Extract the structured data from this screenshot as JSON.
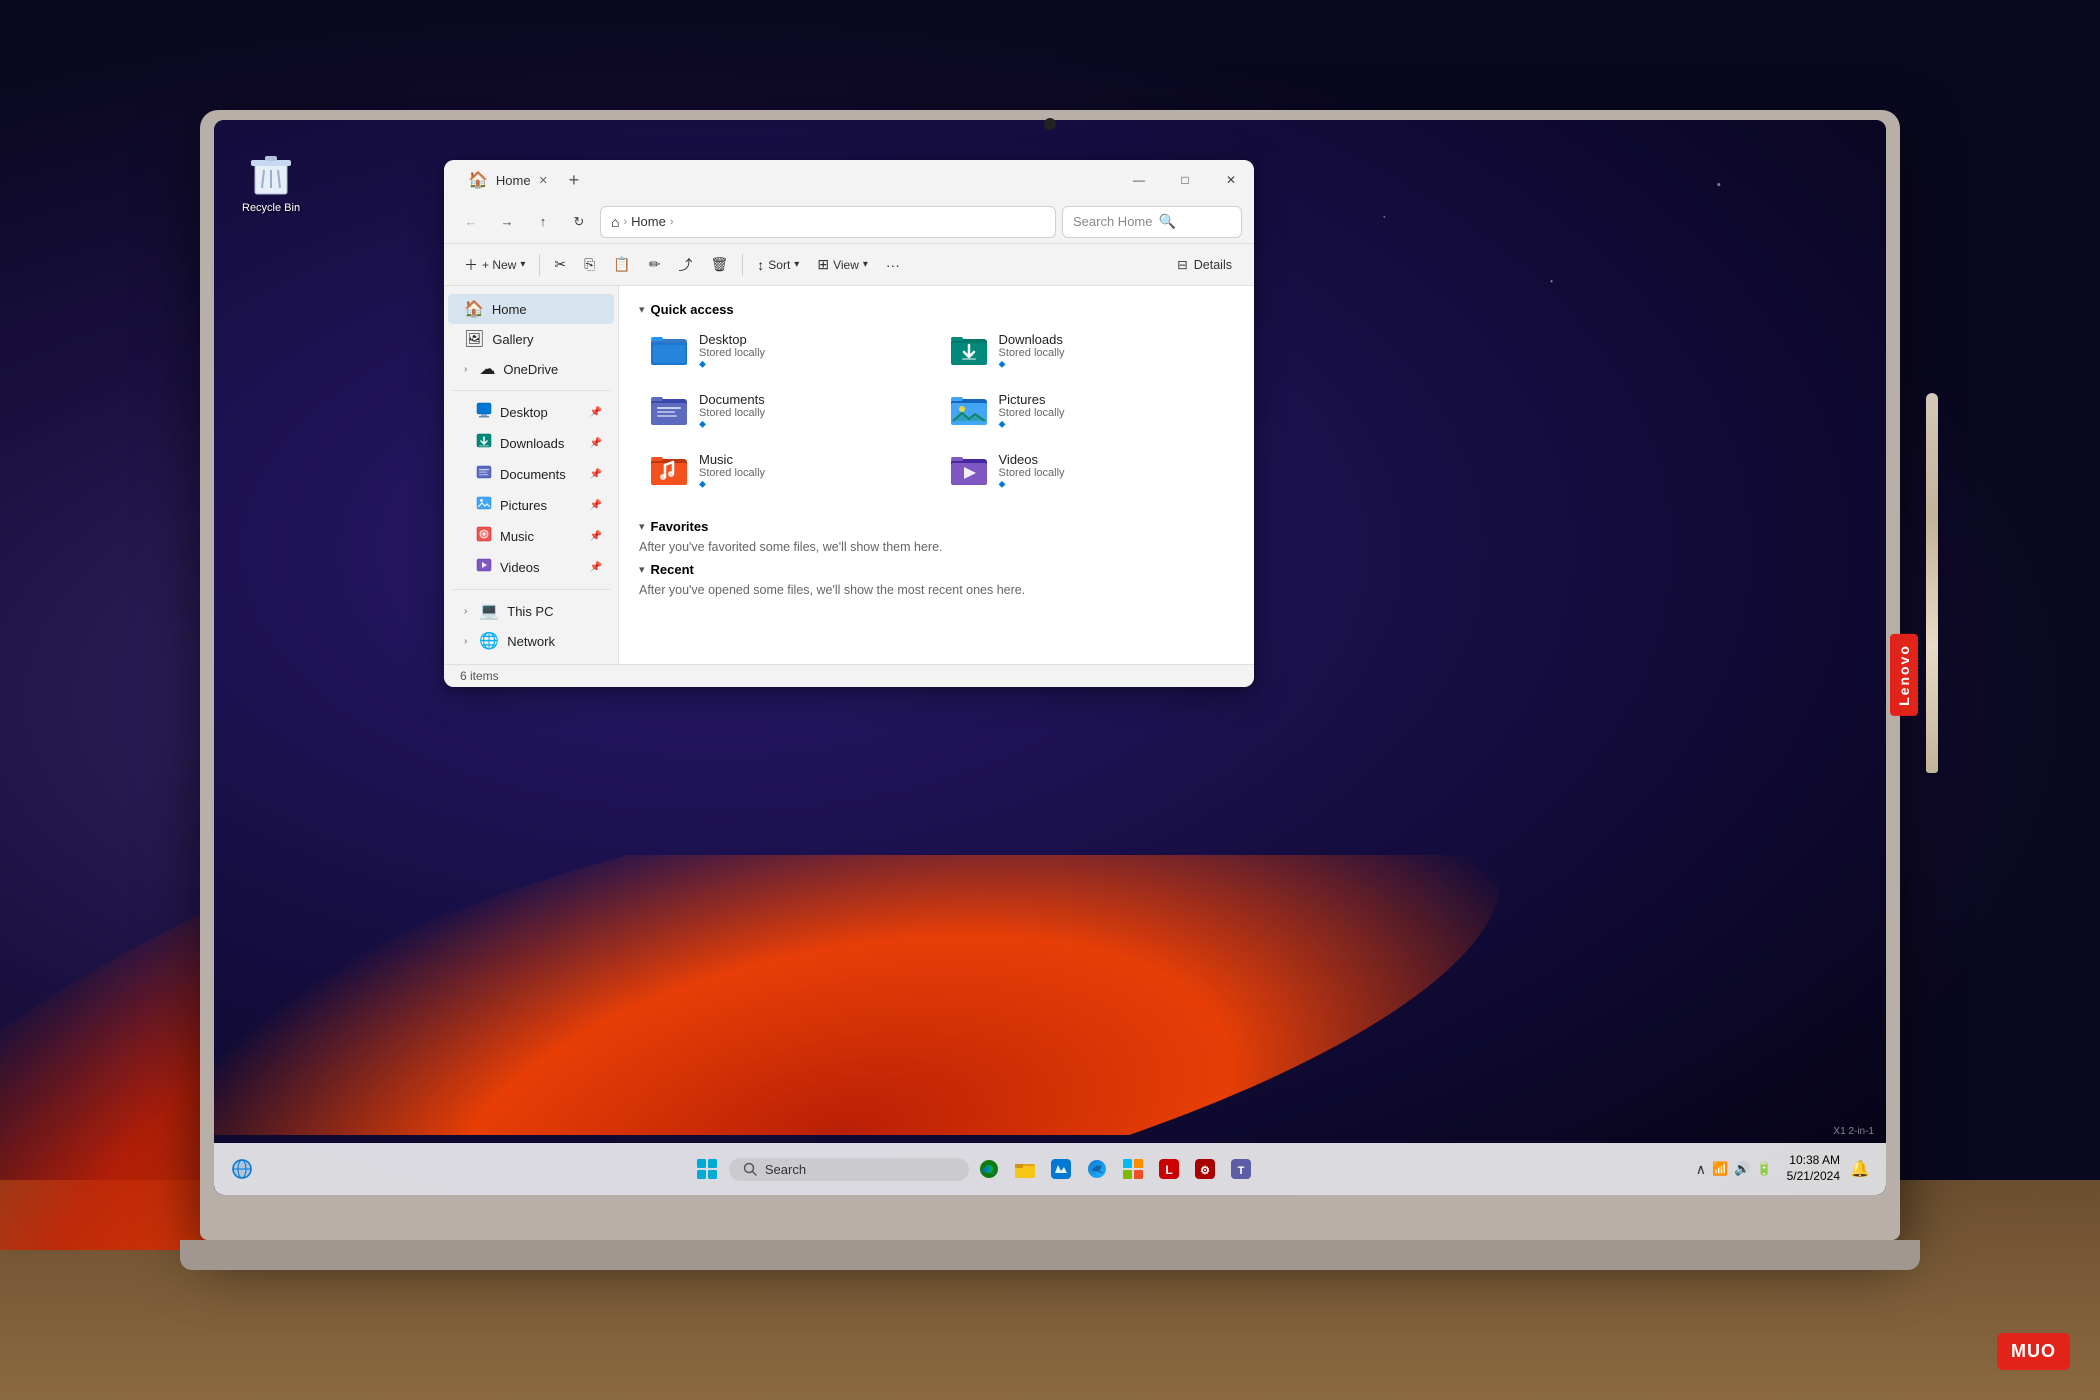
{
  "window_title": "Home",
  "tab_label": "Home",
  "add_tab": "+",
  "window_controls": {
    "minimize": "—",
    "maximize": "□",
    "close": "✕"
  },
  "nav": {
    "back": "←",
    "forward": "→",
    "up": "↑",
    "refresh": "↻",
    "home": "⌂",
    "breadcrumb": [
      "Home"
    ],
    "search_placeholder": "Search Home"
  },
  "commands": {
    "new": "+ New",
    "cut": "✂",
    "copy": "⎘",
    "paste": "📋",
    "rename": "✏",
    "share": "⤴",
    "delete": "🗑",
    "sort": "Sort",
    "view": "View",
    "more": "···",
    "details": "Details"
  },
  "sidebar": {
    "items": [
      {
        "icon": "🏠",
        "label": "Home",
        "active": true
      },
      {
        "icon": "🖼",
        "label": "Gallery"
      },
      {
        "icon": "☁",
        "label": "OneDrive",
        "expandable": true
      },
      {
        "icon": "🖥",
        "label": "Desktop",
        "pinned": true,
        "indent": true
      },
      {
        "icon": "⬇",
        "label": "Downloads",
        "pinned": true,
        "indent": true
      },
      {
        "icon": "📄",
        "label": "Documents",
        "pinned": true,
        "indent": true
      },
      {
        "icon": "🖼",
        "label": "Pictures",
        "pinned": true,
        "indent": true
      },
      {
        "icon": "🎵",
        "label": "Music",
        "pinned": true,
        "indent": true
      },
      {
        "icon": "🎬",
        "label": "Videos",
        "pinned": true,
        "indent": true
      },
      {
        "icon": "💻",
        "label": "This PC",
        "expandable": true
      },
      {
        "icon": "🌐",
        "label": "Network",
        "expandable": true
      }
    ]
  },
  "quick_access": {
    "title": "Quick access",
    "items": [
      {
        "name": "Desktop",
        "sub": "Stored locally",
        "color": "#2196F3",
        "pinned": true
      },
      {
        "name": "Downloads",
        "sub": "Stored locally",
        "color": "#00BFA5",
        "pinned": true
      },
      {
        "name": "Documents",
        "sub": "Stored locally",
        "color": "#5C6BC0",
        "pinned": true
      },
      {
        "name": "Pictures",
        "sub": "Stored locally",
        "color": "#42A5F5",
        "pinned": true
      },
      {
        "name": "Music",
        "sub": "Stored locally",
        "color": "#EF5350",
        "pinned": true
      },
      {
        "name": "Videos",
        "sub": "Stored locally",
        "color": "#7E57C2",
        "pinned": true
      }
    ]
  },
  "favorites": {
    "title": "Favorites",
    "empty_message": "After you've favorited some files, we'll show them here."
  },
  "recent": {
    "title": "Recent",
    "empty_message": "After you've opened some files, we'll show the most recent ones here."
  },
  "status_bar": {
    "count": "6 items"
  },
  "desktop": {
    "recycle_bin_label": "Recycle Bin",
    "recycle_bin_icon": "🗑"
  },
  "taskbar": {
    "search_placeholder": "Search",
    "clock": "10:38 AM",
    "date": "5/21/2024",
    "icons": [
      "🌐",
      "📁",
      "🏪",
      "🌀",
      "🔵",
      "🔴",
      "👥"
    ]
  },
  "lenovo": "Lenovo",
  "muo": "MUO",
  "x1_label": "X1 2-in-1"
}
